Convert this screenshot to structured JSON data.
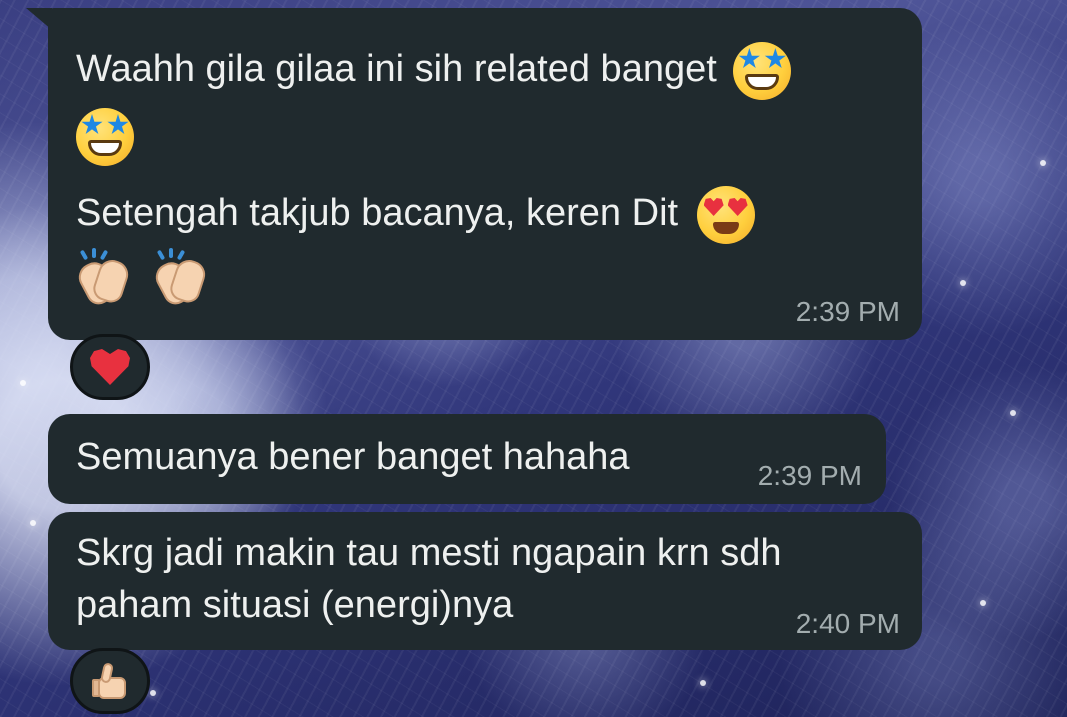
{
  "messages": [
    {
      "line1": "Waahh gila gilaa ini sih related banget",
      "line2_emoji": "star-struck",
      "line3": "Setengah takjub bacanya, keren Dit",
      "line3_emoji": "smiling-face-with-heart-eyes",
      "line4_emoji": [
        "clapping-hands",
        "clapping-hands"
      ],
      "time": "2:39 PM",
      "reaction": "red-heart"
    },
    {
      "text": "Semuanya bener banget hahaha",
      "time": "2:39 PM"
    },
    {
      "line1": "Skrg jadi makin tau mesti ngapain krn sdh",
      "line2": "paham situasi (energi)nya",
      "time": "2:40 PM",
      "reaction": "thumbs-up"
    }
  ],
  "colors": {
    "bubble": "#202a2e",
    "text": "#eef0ef",
    "time": "#a3adaf",
    "heart": "#e8313f"
  }
}
